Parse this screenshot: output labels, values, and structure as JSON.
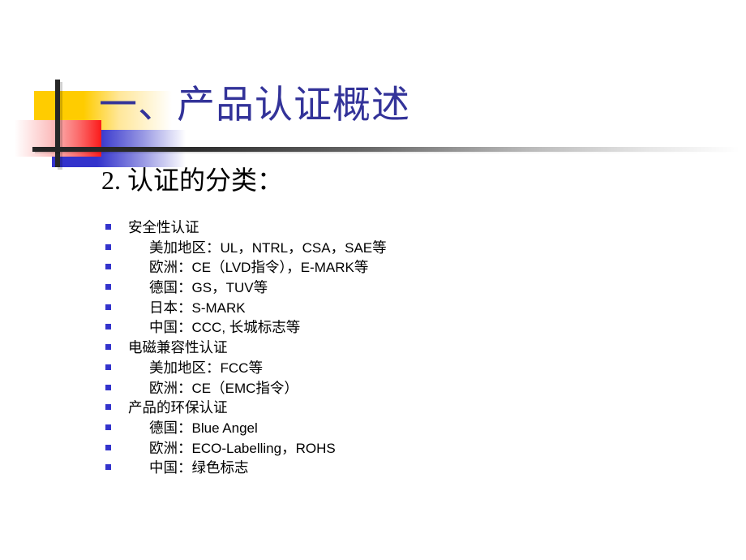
{
  "slide": {
    "title": "一、产品认证概述",
    "subtitle": "2. 认证的分类：",
    "title_color": "#333399",
    "bullet_color": "#3333cc",
    "accent_colors": {
      "yellow": "#ffcc00",
      "red": "#fb1a1a",
      "blue": "#3333cc",
      "bar": "#262626"
    },
    "bullets": [
      {
        "level": 1,
        "text": "安全性认证"
      },
      {
        "level": 2,
        "text": "美加地区：UL，NTRL，CSA，SAE等"
      },
      {
        "level": 2,
        "text": "欧洲：CE（LVD指令），E-MARK等"
      },
      {
        "level": 2,
        "text": "德国：GS，TUV等"
      },
      {
        "level": 2,
        "text": "日本：S-MARK"
      },
      {
        "level": 2,
        "text": "中国：CCC, 长城标志等"
      },
      {
        "level": 1,
        "text": "电磁兼容性认证"
      },
      {
        "level": 2,
        "text": "美加地区：FCC等"
      },
      {
        "level": 2,
        "text": "欧洲：CE（EMC指令）"
      },
      {
        "level": 1,
        "text": "产品的环保认证"
      },
      {
        "level": 2,
        "text": "德国：Blue Angel"
      },
      {
        "level": 2,
        "text": "欧洲：ECO-Labelling，ROHS"
      },
      {
        "level": 2,
        "text": "中国：绿色标志"
      }
    ]
  }
}
